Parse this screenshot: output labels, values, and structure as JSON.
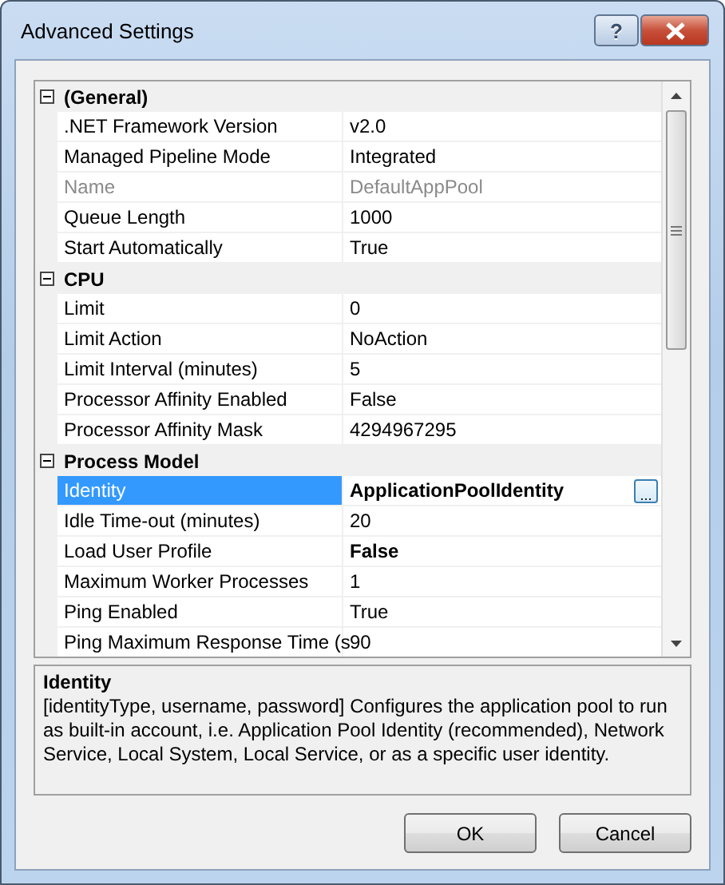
{
  "window": {
    "title": "Advanced Settings",
    "help_button": "?"
  },
  "categories": [
    {
      "name": "(General)",
      "expanded": true,
      "properties": [
        {
          "name": ".NET Framework Version",
          "value": "v2.0",
          "selected": false,
          "disabled": false,
          "modified": false
        },
        {
          "name": "Managed Pipeline Mode",
          "value": "Integrated",
          "selected": false,
          "disabled": false,
          "modified": false
        },
        {
          "name": "Name",
          "value": "DefaultAppPool",
          "selected": false,
          "disabled": true,
          "modified": false
        },
        {
          "name": "Queue Length",
          "value": "1000",
          "selected": false,
          "disabled": false,
          "modified": false
        },
        {
          "name": "Start Automatically",
          "value": "True",
          "selected": false,
          "disabled": false,
          "modified": false
        }
      ]
    },
    {
      "name": "CPU",
      "expanded": true,
      "properties": [
        {
          "name": "Limit",
          "value": "0",
          "selected": false,
          "disabled": false,
          "modified": false
        },
        {
          "name": "Limit Action",
          "value": "NoAction",
          "selected": false,
          "disabled": false,
          "modified": false
        },
        {
          "name": "Limit Interval (minutes)",
          "value": "5",
          "selected": false,
          "disabled": false,
          "modified": false
        },
        {
          "name": "Processor Affinity Enabled",
          "value": "False",
          "selected": false,
          "disabled": false,
          "modified": false
        },
        {
          "name": "Processor Affinity Mask",
          "value": "4294967295",
          "selected": false,
          "disabled": false,
          "modified": false
        }
      ]
    },
    {
      "name": "Process Model",
      "expanded": true,
      "properties": [
        {
          "name": "Identity",
          "value": "ApplicationPoolIdentity",
          "selected": true,
          "disabled": false,
          "modified": true,
          "browse_button": "..."
        },
        {
          "name": "Idle Time-out (minutes)",
          "value": "20",
          "selected": false,
          "disabled": false,
          "modified": false
        },
        {
          "name": "Load User Profile",
          "value": "False",
          "selected": false,
          "disabled": false,
          "modified": true
        },
        {
          "name": "Maximum Worker Processes",
          "value": "1",
          "selected": false,
          "disabled": false,
          "modified": false
        },
        {
          "name": "Ping Enabled",
          "value": "True",
          "selected": false,
          "disabled": false,
          "modified": false
        },
        {
          "name": "Ping Maximum Response Time (s",
          "value": "90",
          "selected": false,
          "disabled": false,
          "modified": false
        }
      ]
    }
  ],
  "description": {
    "title": "Identity",
    "text": "[identityType, username, password] Configures the application pool to run as built-in account, i.e. Application Pool Identity (recommended), Network Service, Local System, Local Service, or as a specific user identity."
  },
  "buttons": [
    "OK",
    "Cancel"
  ]
}
